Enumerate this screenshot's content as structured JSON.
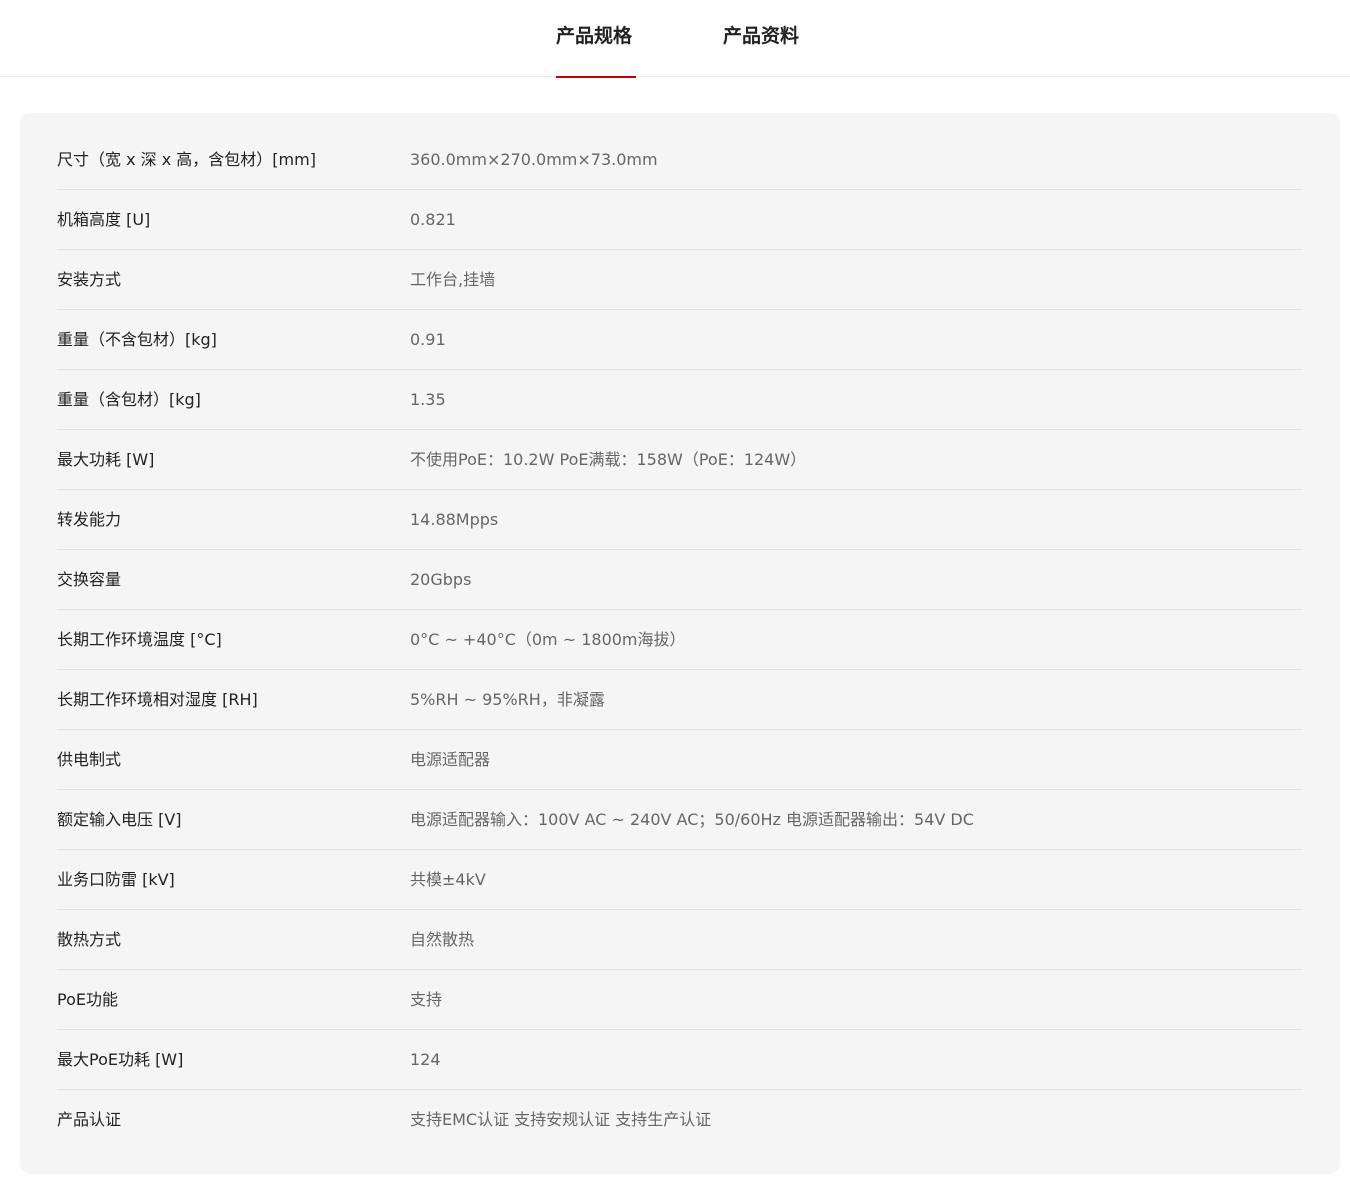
{
  "tabs": [
    {
      "label": "产品规格",
      "active": true
    },
    {
      "label": "产品资料",
      "active": false
    }
  ],
  "accent_color": "#c7000b",
  "specs": [
    {
      "label": "尺寸（宽 x 深 x 高，含包材）[mm]",
      "value": "360.0mm×270.0mm×73.0mm"
    },
    {
      "label": "机箱高度 [U]",
      "value": "0.821"
    },
    {
      "label": "安装方式",
      "value": "工作台,挂墙"
    },
    {
      "label": "重量（不含包材）[kg]",
      "value": "0.91"
    },
    {
      "label": "重量（含包材）[kg]",
      "value": "1.35"
    },
    {
      "label": "最大功耗 [W]",
      "value": "不使用PoE：10.2W PoE满载：158W（PoE：124W）"
    },
    {
      "label": "转发能力",
      "value": "14.88Mpps"
    },
    {
      "label": "交换容量",
      "value": "20Gbps"
    },
    {
      "label": "长期工作环境温度 [°C]",
      "value": "0°C ~ +40°C（0m ~ 1800m海拔）"
    },
    {
      "label": "长期工作环境相对湿度 [RH]",
      "value": "5%RH ~ 95%RH，非凝露"
    },
    {
      "label": "供电制式",
      "value": "电源适配器"
    },
    {
      "label": "额定输入电压 [V]",
      "value": "电源适配器输入：100V AC ~ 240V AC；50/60Hz 电源适配器输出：54V DC"
    },
    {
      "label": "业务口防雷 [kV]",
      "value": "共模±4kV"
    },
    {
      "label": "散热方式",
      "value": "自然散热"
    },
    {
      "label": "PoE功能",
      "value": "支持"
    },
    {
      "label": "最大PoE功耗 [W]",
      "value": "124"
    },
    {
      "label": "产品认证",
      "value": "支持EMC认证 支持安规认证 支持生产认证"
    }
  ]
}
